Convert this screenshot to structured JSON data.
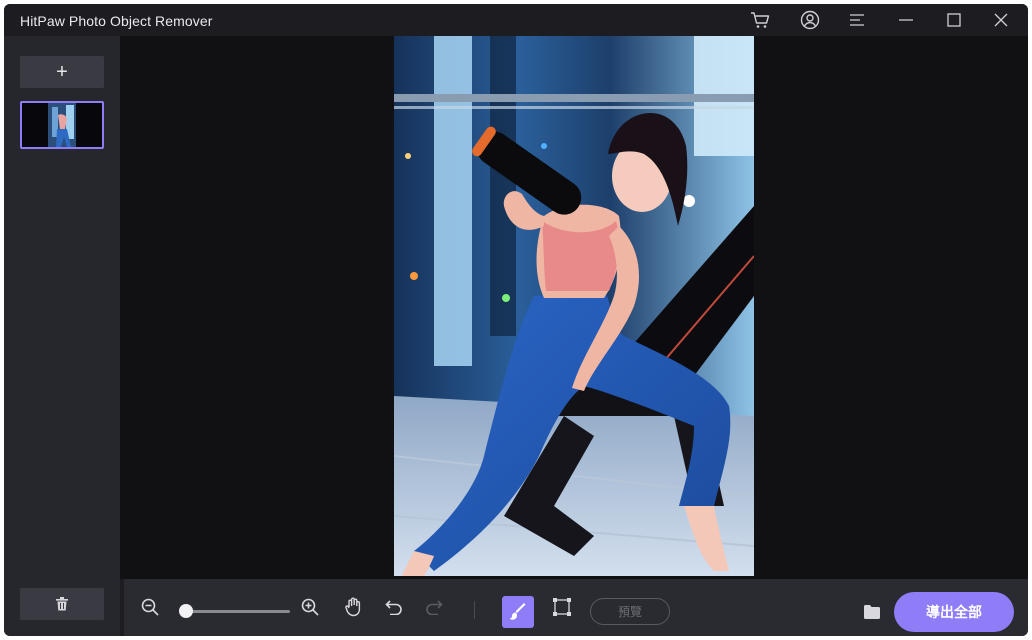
{
  "app": {
    "title": "HitPaw Photo Object Remover"
  },
  "titlebar": {
    "icons": [
      "cart-icon",
      "account-icon",
      "menu-icon",
      "minimize-icon",
      "maximize-icon",
      "close-icon"
    ]
  },
  "sidebar": {
    "add_label": "+",
    "thumbnails": [
      {
        "selected": true
      }
    ],
    "delete_icon": "trash-icon"
  },
  "toolbar": {
    "zoom_level": 0.0,
    "tools": [
      "zoom-out-icon",
      "zoom-in-icon",
      "hand-icon",
      "undo-icon",
      "redo-icon",
      "brush-icon",
      "box-select-icon"
    ],
    "preview_label": "預覽",
    "preview_enabled": false
  },
  "export": {
    "folder_icon": "folder-icon",
    "label": "導出全部"
  },
  "colors": {
    "accent": "#8f7cf7",
    "background": "#1c1c21",
    "panel": "#26262d",
    "canvas": "#111114"
  }
}
